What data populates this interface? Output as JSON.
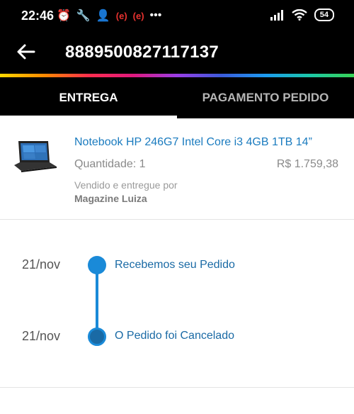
{
  "status_bar": {
    "time": "22:46",
    "indicator_1": "(e)",
    "indicator_2": "(e)",
    "more": "•••",
    "battery": "54"
  },
  "app_bar": {
    "title": "8889500827117137",
    "back_icon": "arrow-left-icon"
  },
  "tabs": [
    {
      "label": "ENTREGA",
      "active": true
    },
    {
      "label": "PAGAMENTO PEDIDO",
      "active": false
    }
  ],
  "product": {
    "name": "Notebook HP 246G7 Intel Core i3 4GB 1TB 14”",
    "quantity": "Quantidade: 1",
    "price": "R$ 1.759,38",
    "sold_by_label": "Vendido e entregue por",
    "seller": "Magazine Luiza"
  },
  "timeline": [
    {
      "date": "21/nov",
      "event": "Recebemos seu Pedido"
    },
    {
      "date": "21/nov",
      "event": "O Pedido foi Cancelado"
    }
  ],
  "footer_partial_text": "",
  "colors": {
    "accent": "#1a8ad8",
    "link": "#1a7bbf",
    "header": "#000000"
  }
}
